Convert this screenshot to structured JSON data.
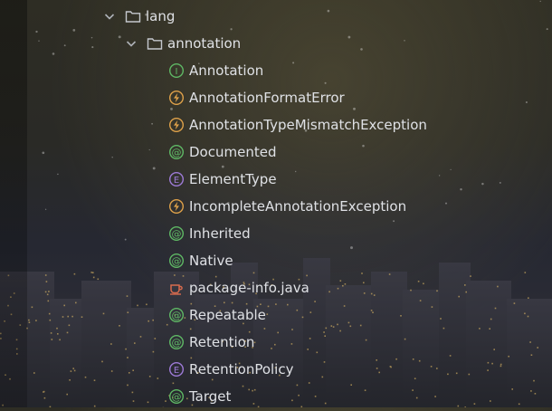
{
  "tree": {
    "folders": [
      {
        "label": "lang",
        "icon": "folder-icon",
        "expanded": true
      },
      {
        "label": "annotation",
        "icon": "folder-icon",
        "expanded": true
      }
    ],
    "items": [
      {
        "label": "Annotation",
        "kind": "interface",
        "icon": "interface-icon",
        "glyph": "I",
        "color": "#5fb865"
      },
      {
        "label": "AnnotationFormatError",
        "kind": "error",
        "icon": "exception-icon",
        "glyph": "⚡",
        "color": "#e0a24a"
      },
      {
        "label": "AnnotationTypeMismatchException",
        "kind": "exception",
        "icon": "exception-icon",
        "glyph": "⚡",
        "color": "#e0a24a"
      },
      {
        "label": "Documented",
        "kind": "annotation",
        "icon": "annotation-icon",
        "glyph": "@",
        "color": "#5fb865"
      },
      {
        "label": "ElementType",
        "kind": "enum",
        "icon": "enum-icon",
        "glyph": "E",
        "color": "#9e7bd8"
      },
      {
        "label": "IncompleteAnnotationException",
        "kind": "exception",
        "icon": "exception-icon",
        "glyph": "⚡",
        "color": "#e0a24a"
      },
      {
        "label": "Inherited",
        "kind": "annotation",
        "icon": "annotation-icon",
        "glyph": "@",
        "color": "#5fb865"
      },
      {
        "label": "Native",
        "kind": "annotation",
        "icon": "annotation-icon",
        "glyph": "@",
        "color": "#5fb865"
      },
      {
        "label": "package-info.java",
        "kind": "java-file",
        "icon": "coffee-cup-icon",
        "glyph": "☕",
        "color": "#d86b4e"
      },
      {
        "label": "Repeatable",
        "kind": "annotation",
        "icon": "annotation-icon",
        "glyph": "@",
        "color": "#5fb865"
      },
      {
        "label": "Retention",
        "kind": "annotation",
        "icon": "annotation-icon",
        "glyph": "@",
        "color": "#5fb865"
      },
      {
        "label": "RetentionPolicy",
        "kind": "enum",
        "icon": "enum-icon",
        "glyph": "E",
        "color": "#9e7bd8"
      },
      {
        "label": "Target",
        "kind": "annotation",
        "icon": "annotation-icon",
        "glyph": "@",
        "color": "#5fb865"
      }
    ]
  }
}
